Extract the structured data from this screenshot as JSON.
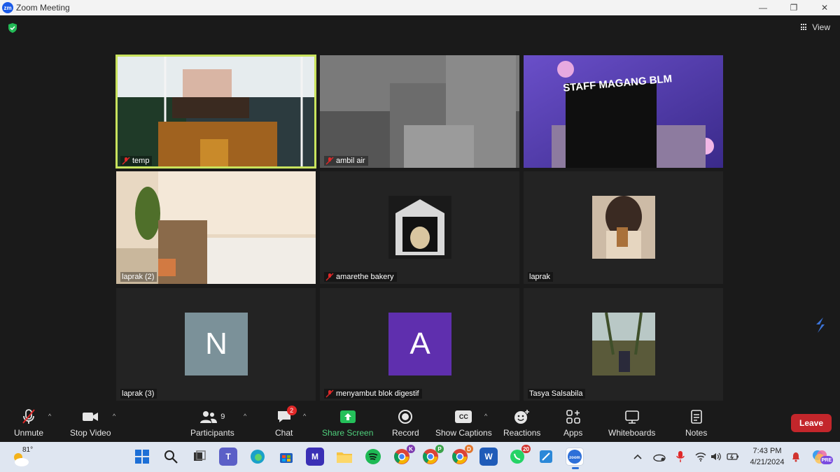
{
  "window": {
    "title": "Zoom Meeting",
    "logo_text": "zm",
    "minimize": "—",
    "maximize": "❐",
    "close": "✕"
  },
  "header": {
    "view_label": "View"
  },
  "tiles": [
    {
      "name": "temp",
      "muted": true
    },
    {
      "name": "ambil air",
      "muted": true
    },
    {
      "name": "",
      "muted": false
    },
    {
      "name": "laprak (2)",
      "muted": false
    },
    {
      "name": "amarethe bakery",
      "muted": true
    },
    {
      "name": "laprak",
      "muted": false
    },
    {
      "name": "laprak (3)",
      "muted": false,
      "avatar_letter": "N",
      "avatar_color": "#7b9199"
    },
    {
      "name": "menyambut blok digestif",
      "muted": true,
      "avatar_letter": "A",
      "avatar_color": "#5f2fae"
    },
    {
      "name": "Tasya Salsabila",
      "muted": false
    }
  ],
  "tile3_banner": "STAFF MAGANG BLM",
  "toolbar": {
    "unmute": "Unmute",
    "stop_video": "Stop Video",
    "participants": "Participants",
    "participants_count": "9",
    "chat": "Chat",
    "chat_badge": "2",
    "share_screen": "Share Screen",
    "record": "Record",
    "captions": "Show Captions",
    "captions_icon_text": "CC",
    "reactions": "Reactions",
    "apps": "Apps",
    "whiteboards": "Whiteboards",
    "notes": "Notes",
    "leave": "Leave"
  },
  "taskbar": {
    "temperature": "81°",
    "badges": {
      "chrome1": "K",
      "chrome2": "P",
      "chrome3": "D",
      "whatsapp": "20"
    },
    "time": "7:43 PM",
    "date": "4/21/2024",
    "copilot_badge": "PRE"
  },
  "colors": {
    "active_speaker": "#c9e35d",
    "leave": "#c3262b",
    "share_screen": "#24c05a",
    "taskbar": "#dfe6f1"
  }
}
